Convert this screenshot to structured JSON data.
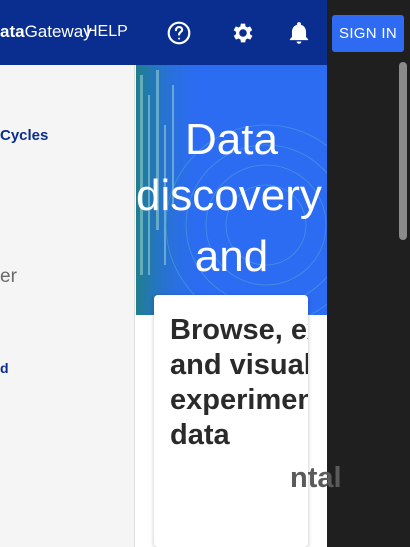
{
  "header": {
    "brand_bold": "ata",
    "brand_rest": "Gateway",
    "help_label": "HELP",
    "sign_in_label": "SIGN IN"
  },
  "drawer": {
    "items": [
      {
        "label": "Cycles"
      },
      {
        "label": "er"
      },
      {
        "label": "d"
      }
    ]
  },
  "hero": {
    "line1": "Data",
    "line2": "discovery",
    "line3": "and"
  },
  "card": {
    "title": "Browse, explore and visualize experimental data"
  },
  "overlay": {
    "text": "ntal"
  },
  "colors": {
    "appbar": "#0a2e8f",
    "accent": "#2f6bf2",
    "hero": "#2c6cf3",
    "overlay": "#1f1f1f"
  }
}
